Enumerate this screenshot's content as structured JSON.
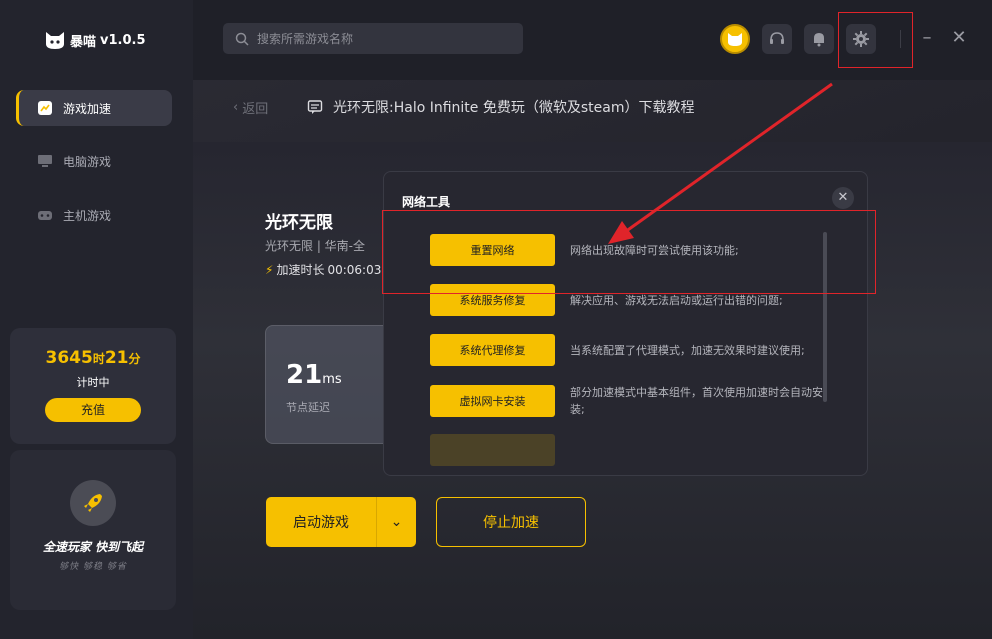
{
  "app": {
    "name": "暴喵",
    "version": "v1.0.5"
  },
  "sidebar": {
    "items": [
      {
        "label": "游戏加速",
        "icon": "speed-icon",
        "active": true
      },
      {
        "label": "电脑游戏",
        "icon": "monitor-icon",
        "active": false
      },
      {
        "label": "主机游戏",
        "icon": "gamepad-icon",
        "active": false
      }
    ],
    "timer": {
      "hours": "3645",
      "hours_unit": "时",
      "minutes": "21",
      "minutes_unit": "分",
      "label": "计时中",
      "recharge": "充值"
    },
    "promo": {
      "title": "全速玩家  快到飞起",
      "sub": "够快 够稳 够省"
    }
  },
  "search": {
    "placeholder": "搜索所需游戏名称"
  },
  "header": {
    "back": "返回",
    "title": "光环无限:Halo Infinite 免费玩（微软及steam）下载教程"
  },
  "game": {
    "name": "光环无限",
    "sub": "光环无限 | 华南-全",
    "accel_label": "加速时长",
    "accel_time": "00:06:03",
    "ping_value": "21",
    "ping_unit": "ms",
    "ping_label": "节点延迟",
    "start": "启动游戏",
    "stop": "停止加速"
  },
  "modal": {
    "title": "网络工具",
    "tools": [
      {
        "label": "重置网络",
        "desc": "网络出现故障时可尝试使用该功能;"
      },
      {
        "label": "系统服务修复",
        "desc": "解决应用、游戏无法启动或运行出错的问题;"
      },
      {
        "label": "系统代理修复",
        "desc": "当系统配置了代理模式，加速无效果时建议使用;"
      },
      {
        "label": "虚拟网卡安装",
        "desc": "部分加速模式中基本组件，首次使用加速时会自动安装;"
      }
    ]
  },
  "colors": {
    "accent": "#f6c000",
    "highlight": "#e0242a"
  }
}
